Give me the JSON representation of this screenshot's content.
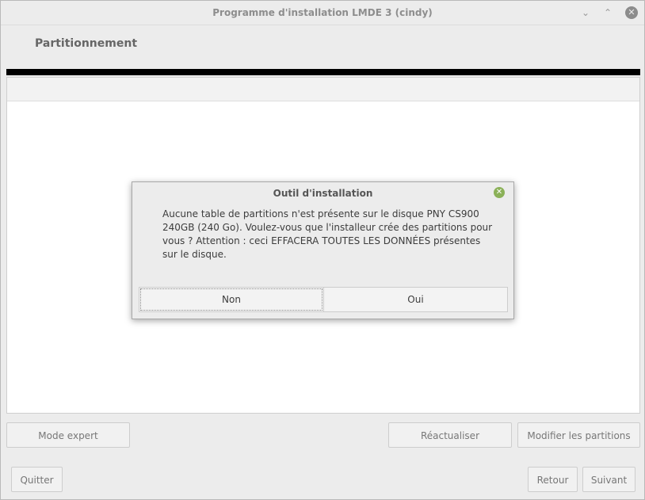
{
  "window": {
    "title": "Programme d'installation LMDE 3 (cindy)",
    "minimize_glyph": "⌄",
    "maximize_glyph": "⌃",
    "close_glyph": "✕"
  },
  "page": {
    "header": "Partitionnement"
  },
  "progress": {
    "fraction": 1.0
  },
  "buttons": {
    "expert": "Mode expert",
    "refresh": "Réactualiser",
    "modify": "Modifier les partitions",
    "quit": "Quitter",
    "back": "Retour",
    "next": "Suivant"
  },
  "dialog": {
    "title": "Outil d'installation",
    "close_glyph": "✕",
    "message": "Aucune table de partitions n'est présente sur le disque PNY CS900 240GB (240 Go). Voulez-vous que l'installeur crée des partitions pour vous ? Attention : ceci EFFACERA TOUTES LES DONNÉES présentes sur le disque.",
    "no_label": "Non",
    "yes_label": "Oui"
  },
  "colors": {
    "progress": "#000000",
    "close_green": "#8bb158"
  }
}
